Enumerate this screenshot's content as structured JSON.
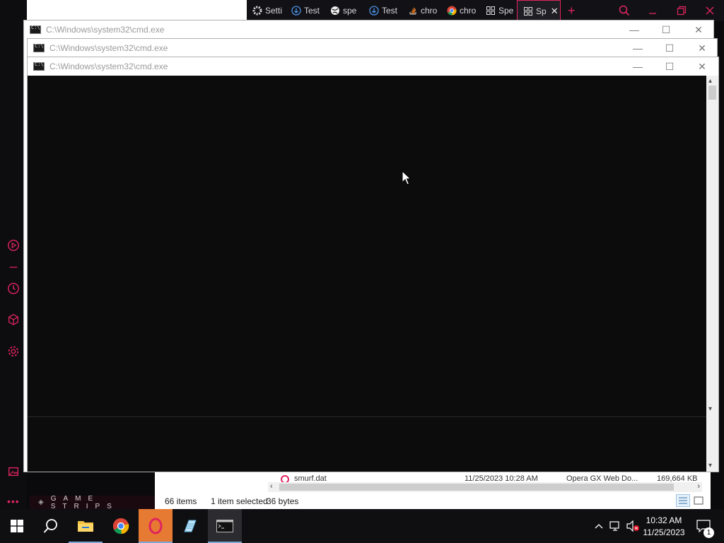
{
  "browser": {
    "tabs": [
      {
        "icon": "gear-icon",
        "label": "Setti"
      },
      {
        "icon": "download-icon",
        "label": "Test"
      },
      {
        "icon": "globe-icon",
        "label": "spe"
      },
      {
        "icon": "download-icon",
        "label": "Test"
      },
      {
        "icon": "stackoverflow-icon",
        "label": "chro"
      },
      {
        "icon": "chrome-icon",
        "label": "chro"
      },
      {
        "icon": "grid-icon",
        "label": "Spe"
      },
      {
        "icon": "grid-icon",
        "label": "Sp",
        "active": true
      }
    ],
    "accent_color": "#e0245e"
  },
  "cmd_windows": [
    {
      "title": "C:\\Windows\\system32\\cmd.exe"
    },
    {
      "title": "C:\\Windows\\system32\\cmd.exe"
    },
    {
      "title": "C:\\Windows\\system32\\cmd.exe"
    }
  ],
  "game_strips": {
    "label": "GAME STRIPS"
  },
  "explorer": {
    "file": {
      "name": "smurf.dat",
      "date": "11/25/2023 10:28 AM",
      "type": "Opera GX Web Do...",
      "size": "169,664 KB"
    },
    "status": {
      "items": "66 items",
      "selected": "1 item selected",
      "size": "36 bytes"
    }
  },
  "taskbar": {
    "apps": [
      {
        "name": "start",
        "icon": "windows-icon"
      },
      {
        "name": "search",
        "icon": "search-icon"
      },
      {
        "name": "file-explorer",
        "icon": "folder-icon"
      },
      {
        "name": "chrome",
        "icon": "chrome-icon"
      },
      {
        "name": "opera-gx",
        "icon": "opera-gx-icon"
      },
      {
        "name": "notepad-like",
        "icon": "pen-paper-icon"
      },
      {
        "name": "cmd",
        "icon": "cmd-icon"
      }
    ],
    "clock": {
      "time": "10:32 AM",
      "date": "11/25/2023"
    },
    "notification_count": "1"
  }
}
